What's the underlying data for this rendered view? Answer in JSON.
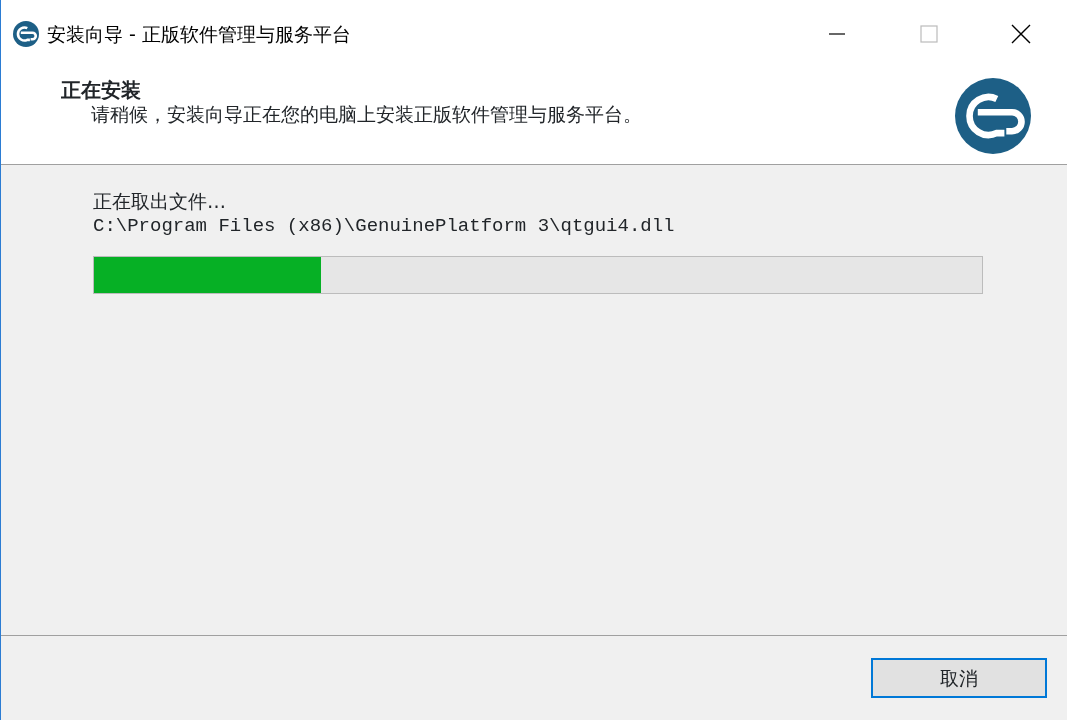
{
  "window": {
    "title": "安装向导 - 正版软件管理与服务平台"
  },
  "header": {
    "title": "正在安装",
    "subtitle": "请稍候，安装向导正在您的电脑上安装正版软件管理与服务平台。"
  },
  "progress": {
    "status": "正在取出文件…",
    "file": "C:\\Program Files (x86)\\GenuinePlatform 3\\qtgui4.dll",
    "level": 0.256
  },
  "buttons": [
    {
      "label": "取消",
      "focused": true
    }
  ]
}
